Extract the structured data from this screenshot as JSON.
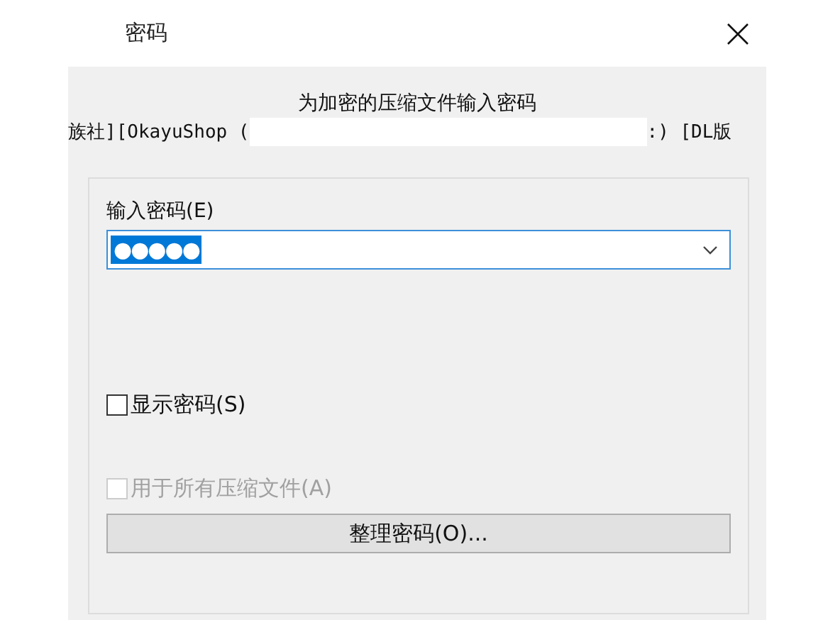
{
  "window": {
    "title": "密码"
  },
  "heading": "为加密的压缩文件输入密码",
  "archive_name": {
    "start": "族社][OkayuShop (",
    "end": ":) [DL版",
    "redacted": true
  },
  "password": {
    "label": "输入密码(E)",
    "value": "●●●●●",
    "selected": true
  },
  "checkboxes": [
    {
      "label": "显示密码(S)",
      "checked": false,
      "disabled": false
    },
    {
      "label": "用于所有压缩文件(A)",
      "checked": false,
      "disabled": true
    }
  ],
  "organize_button": "整理密码(O)..."
}
